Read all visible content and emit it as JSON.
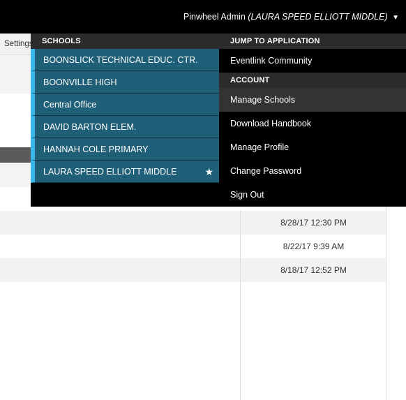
{
  "header": {
    "user_name": "Pinwheel Admin",
    "current_school": "(LAURA SPEED ELLIOTT MIDDLE)"
  },
  "background": {
    "settings_tab_label": "Settings",
    "rows": [
      {
        "date": "8/28/17 12:30 PM"
      },
      {
        "date": "8/22/17 9:39 AM"
      },
      {
        "date": "8/18/17 12:52 PM"
      }
    ]
  },
  "dropdown": {
    "schools_header": "SCHOOLS",
    "schools": [
      {
        "label": "BOONSLICK TECHNICAL EDUC. CTR."
      },
      {
        "label": "BOONVILLE HIGH"
      },
      {
        "label": "Central Office"
      },
      {
        "label": "DAVID BARTON ELEM."
      },
      {
        "label": "HANNAH COLE PRIMARY"
      },
      {
        "label": "LAURA SPEED ELLIOTT MIDDLE",
        "favorite_icon": "star-icon"
      }
    ],
    "jump_header": "JUMP TO APPLICATION",
    "applications": [
      {
        "label": "Eventlink Community"
      }
    ],
    "account_header": "ACCOUNT",
    "account_items": [
      {
        "label": "Manage Schools"
      },
      {
        "label": "Download Handbook"
      },
      {
        "label": "Manage Profile"
      },
      {
        "label": "Change Password"
      },
      {
        "label": "Sign Out"
      }
    ]
  },
  "colors": {
    "topbar": "#000000",
    "school_item_bg": "#1f5f78",
    "school_item_accent": "#38b7e8",
    "section_header_bg": "#2b2b2b",
    "active_item_bg": "#333333"
  }
}
